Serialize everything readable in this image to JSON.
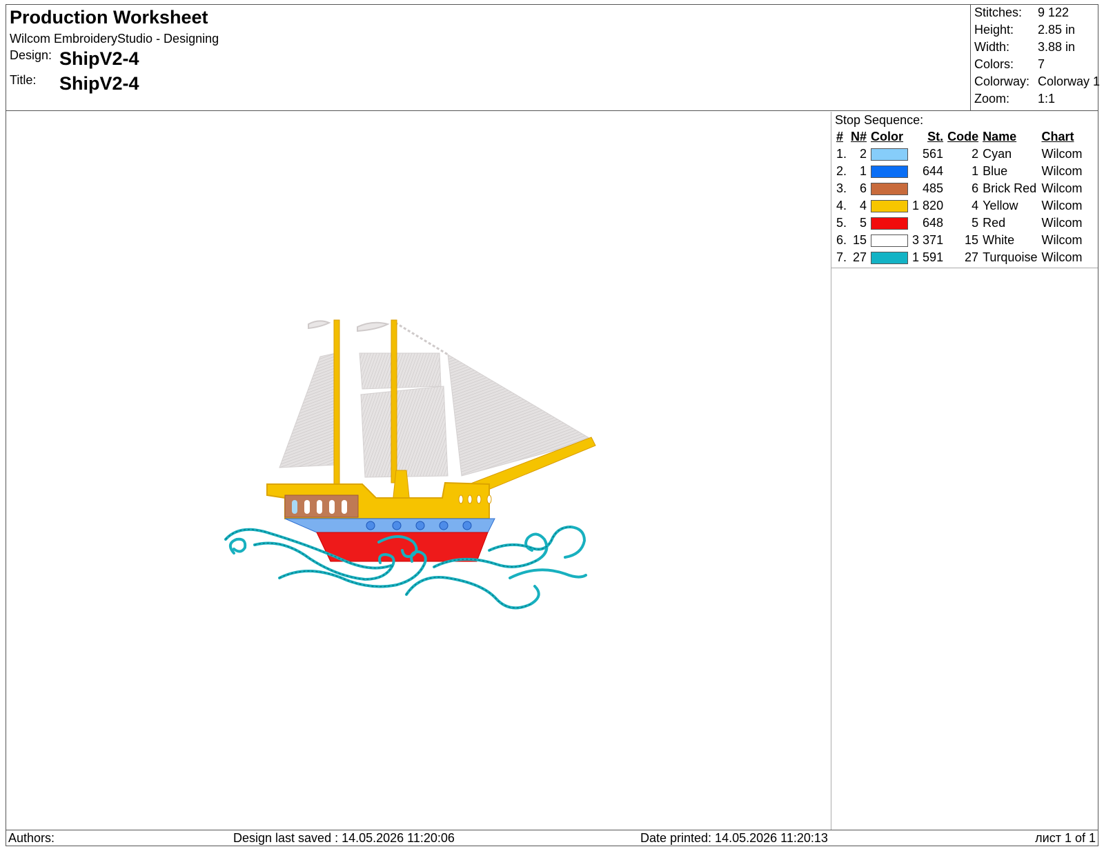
{
  "header": {
    "title": "Production Worksheet",
    "app": "Wilcom EmbroideryStudio - Designing",
    "design_label": "Design:",
    "design_value": "ShipV2-4",
    "title_label": "Title:",
    "title_value": "ShipV2-4"
  },
  "stats": [
    {
      "k": "Stitches:",
      "v": "9 122"
    },
    {
      "k": "Height:",
      "v": "2.85 in"
    },
    {
      "k": "Width:",
      "v": "3.88 in"
    },
    {
      "k": "Colors:",
      "v": "7"
    },
    {
      "k": "Colorway:",
      "v": "Colorway 1"
    },
    {
      "k": "Zoom:",
      "v": "1:1"
    }
  ],
  "sequence": {
    "heading": "Stop Sequence:",
    "columns": [
      "#",
      "N#",
      "Color",
      "St.",
      "Code",
      "Name",
      "Chart"
    ],
    "rows": [
      {
        "idx": "1.",
        "n": "2",
        "color": "#86cdfa",
        "st": "561",
        "code": "2",
        "name": "Cyan",
        "chart": "Wilcom"
      },
      {
        "idx": "2.",
        "n": "1",
        "color": "#0a6ef5",
        "st": "644",
        "code": "1",
        "name": "Blue",
        "chart": "Wilcom"
      },
      {
        "idx": "3.",
        "n": "6",
        "color": "#c86b3c",
        "st": "485",
        "code": "6",
        "name": "Brick Red",
        "chart": "Wilcom"
      },
      {
        "idx": "4.",
        "n": "4",
        "color": "#f7c600",
        "st": "1 820",
        "code": "4",
        "name": "Yellow",
        "chart": "Wilcom"
      },
      {
        "idx": "5.",
        "n": "5",
        "color": "#f20c0c",
        "st": "648",
        "code": "5",
        "name": "Red",
        "chart": "Wilcom"
      },
      {
        "idx": "6.",
        "n": "15",
        "color": "#ffffff",
        "st": "3 371",
        "code": "15",
        "name": "White",
        "chart": "Wilcom"
      },
      {
        "idx": "7.",
        "n": "27",
        "color": "#13b3c5",
        "st": "1 591",
        "code": "27",
        "name": "Turquoise",
        "chart": "Wilcom"
      }
    ]
  },
  "footer": {
    "authors": "Authors:",
    "saved": "Design last saved : 14.05.2026 11:20:06",
    "printed": "Date printed: 14.05.2026 11:20:13",
    "page": "лист 1 of 1"
  }
}
